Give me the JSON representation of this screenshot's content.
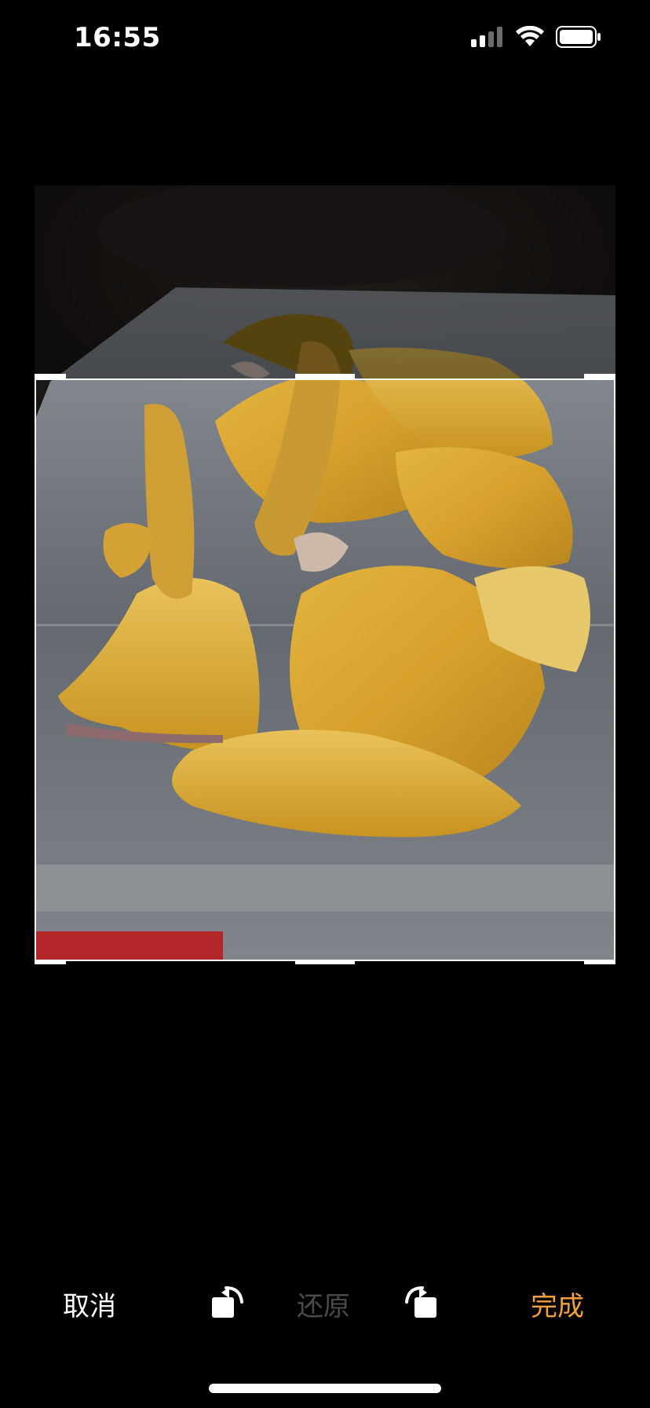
{
  "status_bar": {
    "time": "16:55",
    "icons": [
      "cellular-signal-icon",
      "wifi-icon",
      "battery-icon"
    ]
  },
  "editor": {
    "photo_subject": "photo-of-chicken-pieces-in-plastic-container"
  },
  "toolbar": {
    "cancel_label": "取消",
    "rotate_left_icon": "rotate-left-icon",
    "reset_label": "还原",
    "rotate_right_icon": "rotate-right-icon",
    "done_label": "完成"
  },
  "colors": {
    "background": "#000000",
    "accent": "#f2a03d",
    "disabled": "#4a4a4a",
    "crop_border": "#ffffff"
  }
}
